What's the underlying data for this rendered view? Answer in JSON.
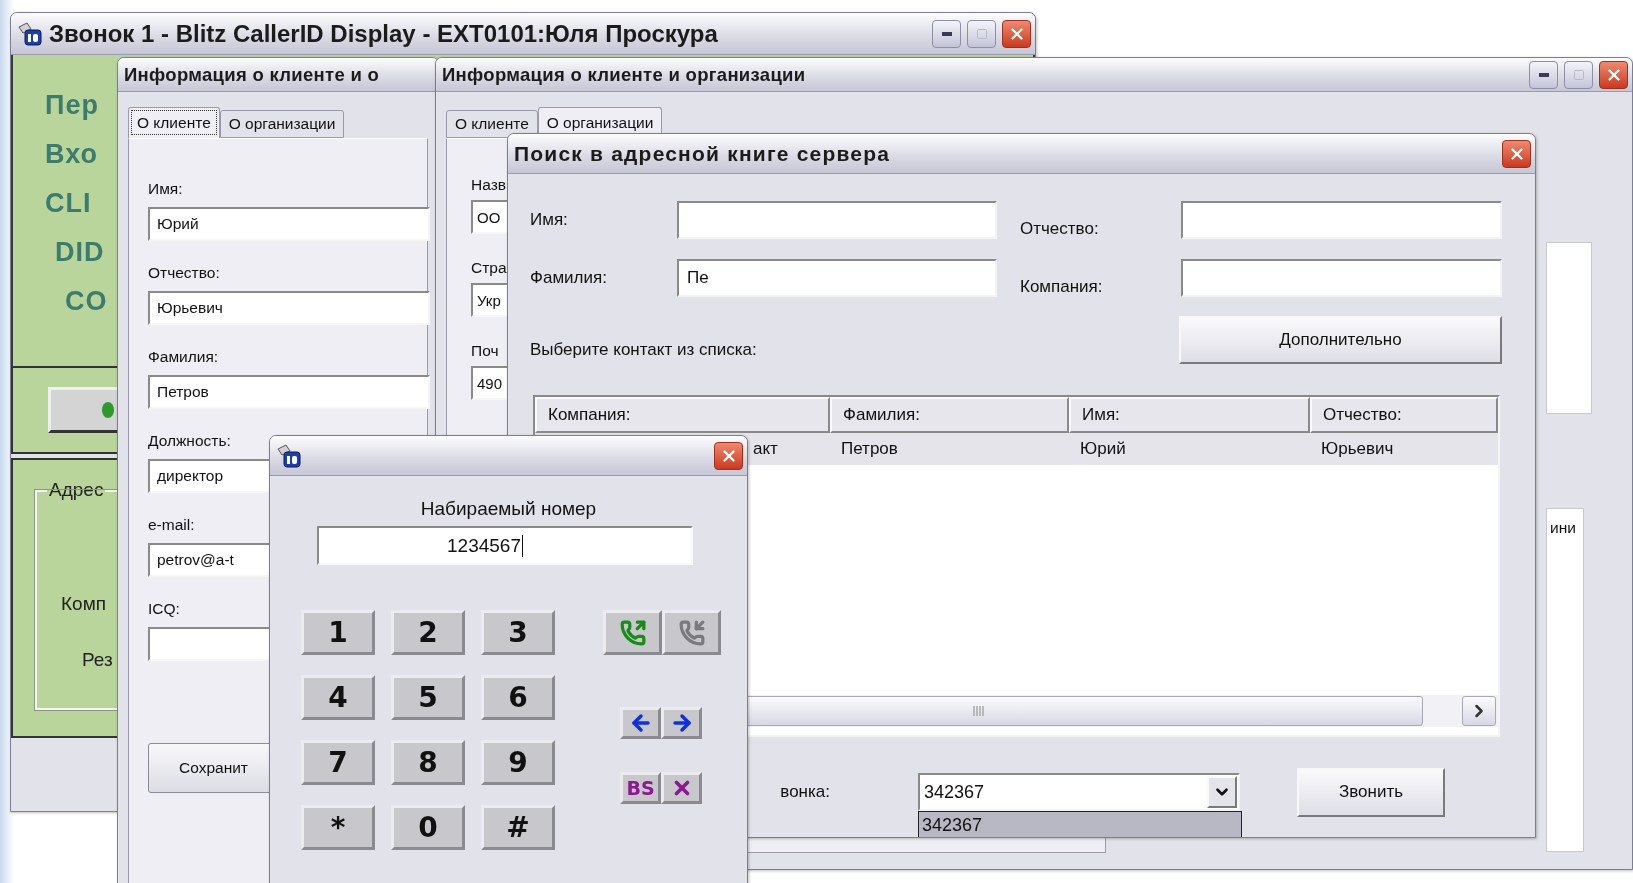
{
  "main_window": {
    "title": "Звонок 1 - Blitz CallerID Display - EXT0101:Юля Проскура",
    "caller_labels": [
      "Пер",
      "Вхо",
      "CLI",
      "DID",
      "CO"
    ],
    "address_group": {
      "legend": "Адрес",
      "labels": [
        "Комп",
        "Рез"
      ]
    }
  },
  "client_window": {
    "title": "Информация о клиенте и о",
    "tabs": [
      {
        "label": "О клиенте",
        "selected": true
      },
      {
        "label": "О организации",
        "selected": false
      }
    ],
    "fields": [
      {
        "label": "Имя:",
        "value": "Юрий"
      },
      {
        "label": "Отчество:",
        "value": "Юрьевич"
      },
      {
        "label": "Фамилия:",
        "value": "Петров"
      },
      {
        "label": "Должность:",
        "value": "директор"
      },
      {
        "label": "e-mail:",
        "value": "petrov@a-t"
      },
      {
        "label": "ICQ:"
      }
    ],
    "save_button": "Сохранит"
  },
  "organization_window": {
    "title": "Информация о клиенте и организации",
    "tabs": [
      {
        "label": "О клиенте",
        "selected": false
      },
      {
        "label": "О организации",
        "selected": true
      }
    ],
    "fields": [
      {
        "label": "Назв",
        "value": "ОО"
      },
      {
        "label": "Стра",
        "value": "Укр"
      },
      {
        "label": "Поч",
        "value": "490"
      }
    ],
    "side_text": "ини"
  },
  "search_dialog": {
    "title": "Поиск в адресной книге сервера",
    "fields": [
      {
        "label": "Имя:"
      },
      {
        "label": "Отчество:"
      },
      {
        "label": "Фамилия:",
        "value": "Пе"
      },
      {
        "label": "Компания:"
      }
    ],
    "more_button": "Дополнительно",
    "list_label": "Выберите контакт из списка:",
    "table": {
      "columns": [
        "Компания:",
        "Фамилия:",
        "Имя:",
        "Отчество:"
      ],
      "rows": [
        {
          "cells": [
            "акт",
            "Петров",
            "Юрий",
            "Юрьевич"
          ],
          "selected": true
        }
      ]
    },
    "number_label": "вонка:",
    "number_combo": {
      "value": "342367",
      "options": [
        {
          "label": "342367",
          "selected": true
        }
      ]
    },
    "call_button": "Звонить"
  },
  "dialer": {
    "label": "Набираемый номер",
    "number": "1234567",
    "keys": [
      "1",
      "2",
      "3",
      "4",
      "5",
      "6",
      "7",
      "8",
      "9",
      "*",
      "0",
      "#"
    ],
    "call_buttons": [
      {
        "kind": "call",
        "disabled": false
      },
      {
        "kind": "hangup",
        "disabled": true
      }
    ],
    "edit_keys": [
      {
        "kind": "left"
      },
      {
        "kind": "right"
      },
      {
        "kind": "backspace",
        "label": "BS"
      },
      {
        "kind": "clear"
      }
    ]
  }
}
